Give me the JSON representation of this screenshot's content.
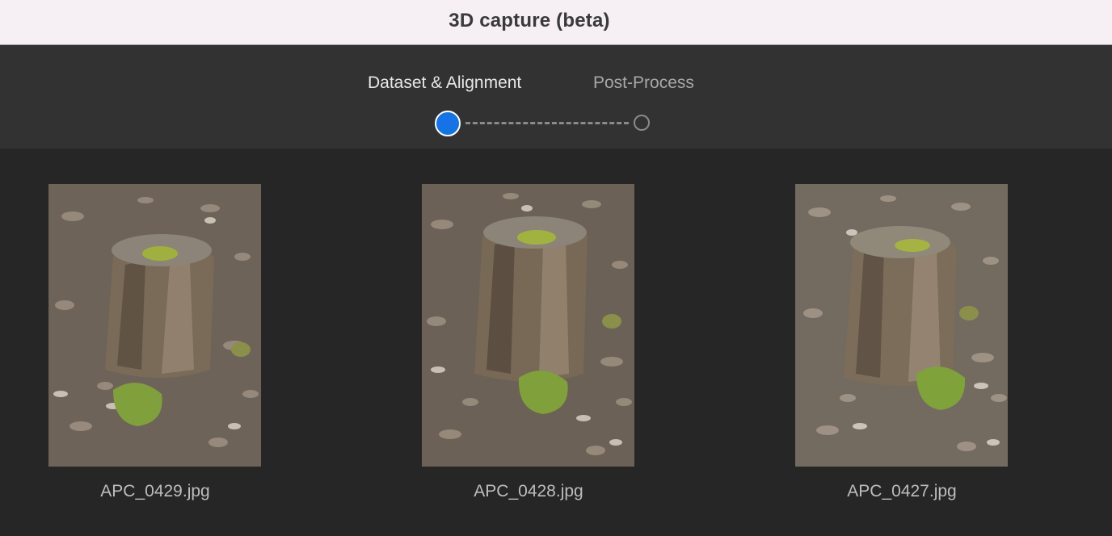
{
  "window": {
    "title": "3D capture (beta)"
  },
  "stepper": {
    "steps": [
      {
        "label": "Dataset & Alignment",
        "state": "active"
      },
      {
        "label": "Post-Process",
        "state": "inactive"
      }
    ],
    "accent_color": "#1473e6"
  },
  "gallery": {
    "items": [
      {
        "filename": "APC_0429.jpg",
        "subject": "tree-stump-photo"
      },
      {
        "filename": "APC_0428.jpg",
        "subject": "tree-stump-photo"
      },
      {
        "filename": "APC_0427.jpg",
        "subject": "tree-stump-photo"
      }
    ]
  }
}
